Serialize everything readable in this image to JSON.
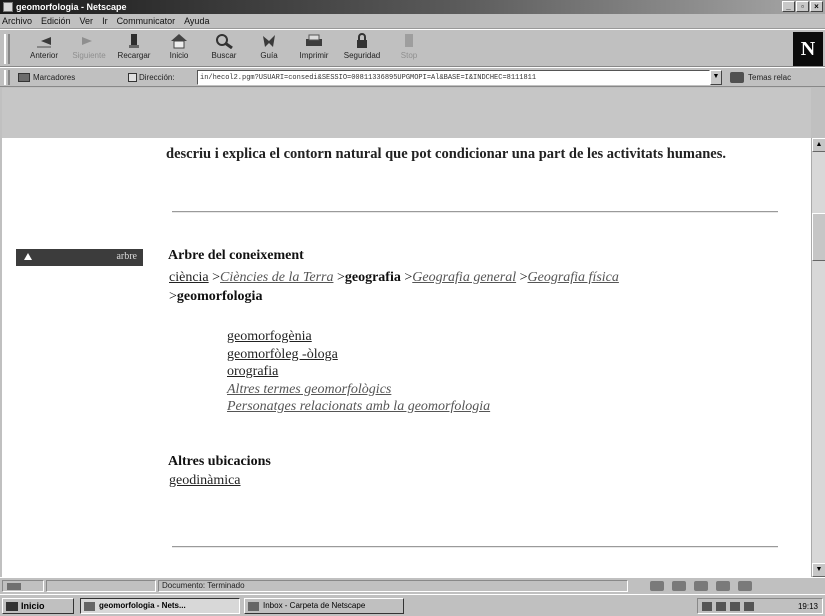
{
  "window": {
    "title": "geomorfologia - Netscape",
    "buttons": [
      "_",
      "▫",
      "×"
    ]
  },
  "menu": [
    "Archivo",
    "Edición",
    "Ver",
    "Ir",
    "Communicator",
    "Ayuda"
  ],
  "toolbar": {
    "buttons": [
      {
        "label": "Anterior",
        "icon": "back-arrow-icon",
        "enabled": true
      },
      {
        "label": "Siguiente",
        "icon": "forward-arrow-icon",
        "enabled": false
      },
      {
        "label": "Recargar",
        "icon": "reload-icon",
        "enabled": true
      },
      {
        "label": "Inicio",
        "icon": "home-icon",
        "enabled": true
      },
      {
        "label": "Buscar",
        "icon": "search-icon",
        "enabled": true
      },
      {
        "label": "Guía",
        "icon": "guide-icon",
        "enabled": true
      },
      {
        "label": "Imprimir",
        "icon": "print-icon",
        "enabled": true
      },
      {
        "label": "Seguridad",
        "icon": "lock-icon",
        "enabled": true
      },
      {
        "label": "Stop",
        "icon": "stop-icon",
        "enabled": false
      }
    ],
    "logo": "N"
  },
  "location": {
    "bookmarks_label": "Marcadores",
    "address_label": "Dirección:",
    "url": "in/hecol2.pgm?USUARI=consedi&SESSIO=00811336895UPGMOPI=Al&BASE=I&INDCHEC=8111811",
    "related_label": "Temas relac"
  },
  "page": {
    "intro_text": "descriu i explica el contorn natural que pot condicionar una part de les activitats humanes.",
    "sidebar_tab": "arbre",
    "tree_title": "Arbre del coneixement",
    "breadcrumb": {
      "link1": "ciència",
      "link2": "Ciències de la Terra",
      "bold1": "geografia",
      "link3": "Geografia general",
      "link4": "Geografia física",
      "current": "geomorfologia",
      "sep": ">"
    },
    "sub_items": [
      {
        "text": "geomorfogènia",
        "style": "normal"
      },
      {
        "text": "geomorfòleg -òloga",
        "style": "normal"
      },
      {
        "text": "orografia",
        "style": "normal"
      },
      {
        "text": "Altres termes geomorfològics",
        "style": "italic"
      },
      {
        "text": "Personatges relacionats amb la geomorfologia",
        "style": "italic"
      }
    ],
    "other_locations_title": "Altres ubicacions",
    "other_location_link": "geodinàmica"
  },
  "status": {
    "text": "Documento: Terminado"
  },
  "taskbar": {
    "start": "Inicio",
    "tasks": [
      {
        "label": "geomorfologia - Nets...",
        "active": true
      },
      {
        "label": "Inbox - Carpeta de Netscape",
        "active": false
      }
    ],
    "clock": "19:13"
  }
}
